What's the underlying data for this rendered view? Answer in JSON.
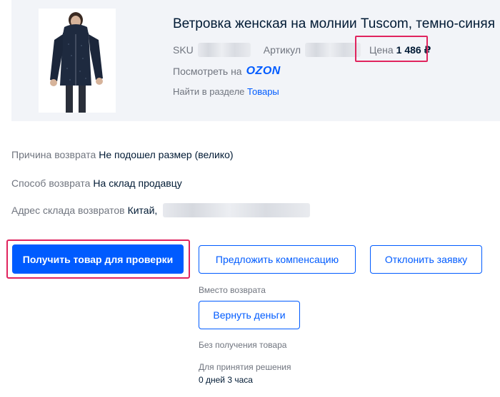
{
  "product": {
    "title": "Ветровка женская на молнии Tuscom, темно-синяя",
    "sku_label": "SKU",
    "article_label": "Артикул",
    "price_label": "Цена",
    "price_value": "1 486 ₽",
    "view_on_label": "Посмотреть на",
    "ozon_logo": "OZON",
    "find_in_section_label": "Найти в разделе",
    "find_in_section_link": "Товары",
    "image_icon": "jacket-photo",
    "image_color": "#1e2a3f"
  },
  "details": {
    "reason_label": "Причина возврата",
    "reason_value": "Не подошел размер (велико)",
    "method_label": "Способ возврата",
    "method_value": "На склад продавцу",
    "address_label": "Адрес склада возвратов",
    "address_value": "Китай,"
  },
  "actions": {
    "receive_button": "Получить товар для проверки",
    "compensation_button": "Предложить компенсацию",
    "reject_button": "Отклонить заявку",
    "instead_of_return_note": "Вместо возврата",
    "refund_button": "Вернуть деньги",
    "without_receiving_note": "Без получения товара",
    "decision_deadline_label": "Для принятия решения",
    "decision_deadline_value": "0 дней 3 часа"
  },
  "colors": {
    "accent": "#005bff",
    "highlight": "#e0245e",
    "card_bg": "#f2f4f8"
  }
}
